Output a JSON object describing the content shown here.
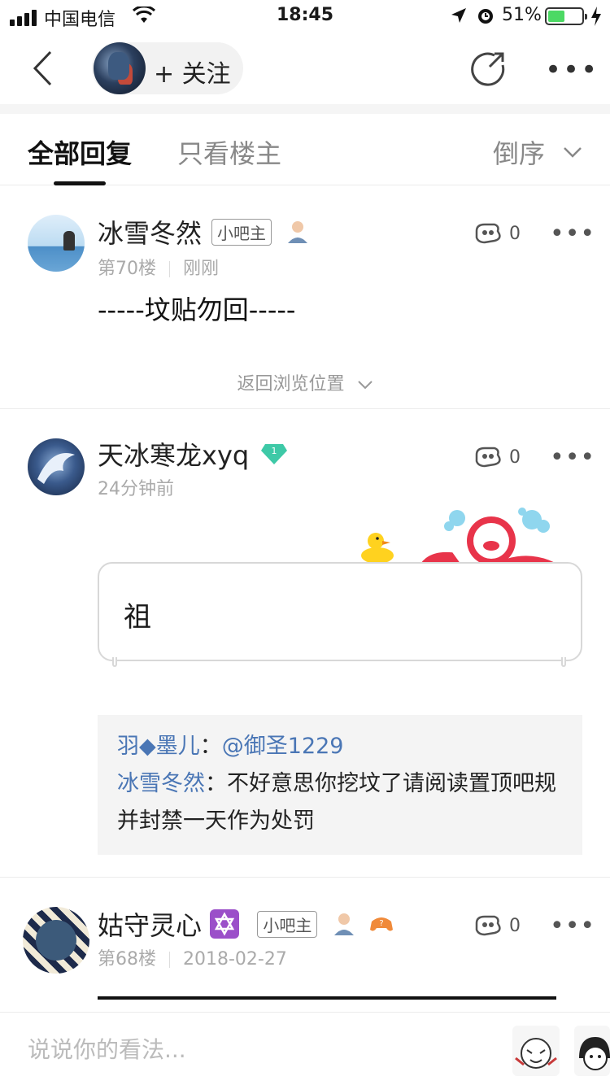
{
  "status_bar": {
    "carrier": "中国电信",
    "time": "18:45",
    "battery_pct": "51%",
    "battery_level": 0.51
  },
  "nav": {
    "follow_label": "+ 关注",
    "icons": [
      "back-icon",
      "share-icon",
      "more-icon"
    ]
  },
  "tabs": {
    "all_replies": "全部回复",
    "owner_only": "只看楼主",
    "sort_label": "倒序"
  },
  "posts": [
    {
      "username": "冰雪冬然",
      "badge": "小吧主",
      "floor": "第70楼",
      "time": "刚刚",
      "content": "-----坟贴勿回-----",
      "likes": "0"
    },
    {
      "username": "天冰寒龙xyq",
      "level": "1",
      "time": "24分钟前",
      "content": "祖",
      "likes": "0",
      "replies": [
        {
          "who": "羽◆墨儿",
          "sep": "：",
          "text": "@御圣1229"
        },
        {
          "who": "冰雪冬然",
          "sep": "：",
          "text": "不好意思你挖坟了请阅读置顶吧规并封禁一天作为处罚"
        }
      ]
    },
    {
      "username": "姑守灵心",
      "badge": "小吧主",
      "floor": "第68楼",
      "time": "2018-02-27",
      "likes": "0"
    }
  ],
  "return_position": "返回浏览位置",
  "comment_placeholder": "说说你的看法...",
  "colors": {
    "link_blue": "#4a76b5",
    "battery_green": "#4cd964",
    "level_badge": "#3ec9a7"
  }
}
